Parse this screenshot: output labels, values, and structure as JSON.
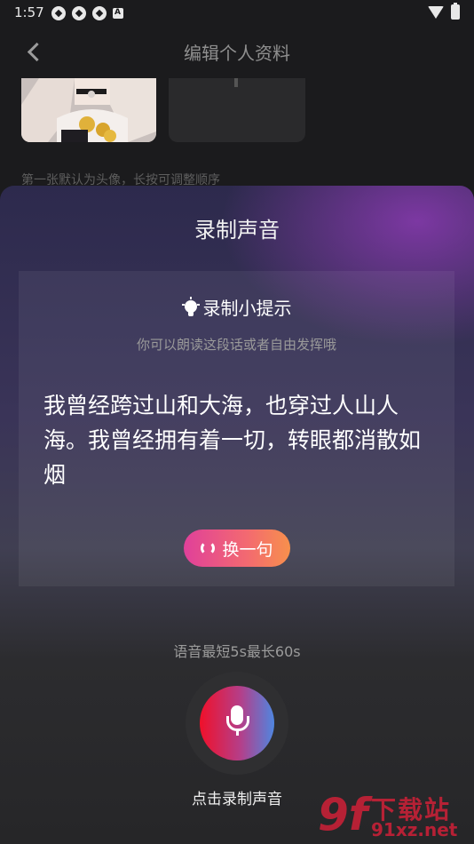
{
  "status_bar": {
    "time": "1:57"
  },
  "header": {
    "title": "编辑个人资料"
  },
  "photos": {
    "hint": "第一张默认为头像，长按可调整顺序"
  },
  "sheet": {
    "title": "录制声音",
    "tips": {
      "title": "录制小提示",
      "subtitle": "你可以朗读这段话或者自由发挥哦",
      "text": "我曾经跨过山和大海，也穿过人山人海。我曾经拥有着一切，转眼都消散如烟"
    },
    "change_button": "换一句",
    "limit_text": "语音最短5s最长60s",
    "record_label": "点击录制声音"
  },
  "watermark": {
    "logo": "9f",
    "text": "下载站",
    "url": "91xz.net"
  },
  "colors": {
    "accent_gradient_start": "#e0409a",
    "accent_gradient_end": "#f7904c",
    "mic_red": "#f0102a",
    "mic_blue": "#4f86e0"
  }
}
